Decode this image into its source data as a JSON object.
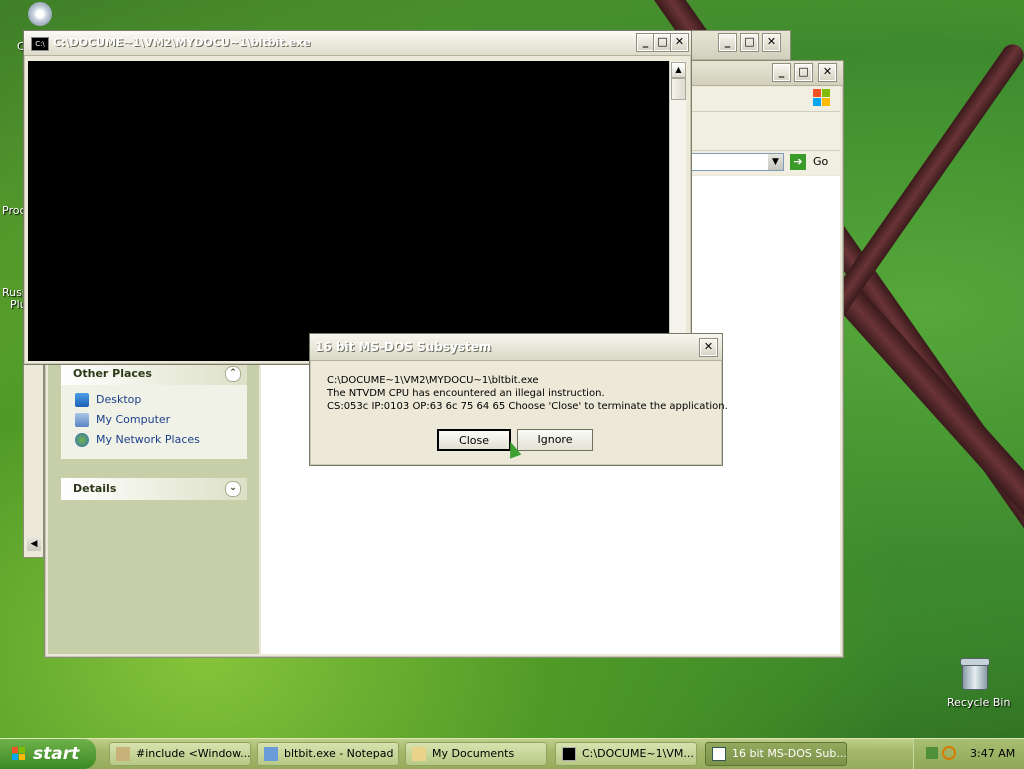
{
  "desktop": {
    "left_labels": [
      "C",
      "Proc",
      "Russ",
      "Plu"
    ],
    "recycle_bin": "Recycle Bin"
  },
  "explorer": {
    "go_label": "Go",
    "other_places": {
      "title": "Other Places",
      "items": [
        "Desktop",
        "My Computer",
        "My Network Places"
      ]
    },
    "details": {
      "title": "Details"
    }
  },
  "cmd_window": {
    "title": "C:\\DOCUME~1\\VM2\\MYDOCU~1\\bltbit.exe"
  },
  "dialog": {
    "title": "16 bit MS-DOS Subsystem",
    "lines": [
      "C:\\DOCUME~1\\VM2\\MYDOCU~1\\bltbit.exe",
      "The NTVDM CPU has encountered an illegal instruction.",
      "CS:053c IP:0103 OP:63 6c 75 64 65 Choose 'Close' to terminate the application."
    ],
    "close_label": "Close",
    "ignore_label": "Ignore"
  },
  "taskbar": {
    "start_label": "start",
    "tasks": [
      "#include <Window...",
      "bltbit.exe - Notepad",
      "My Documents",
      "C:\\DOCUME~1\\VM...",
      "16 bit MS-DOS Sub..."
    ],
    "clock": "3:47 AM"
  },
  "colors": {
    "xp_olive_title": "#d2d0bd",
    "start_green": "#3a8a23",
    "task_active": "#7b934a"
  }
}
